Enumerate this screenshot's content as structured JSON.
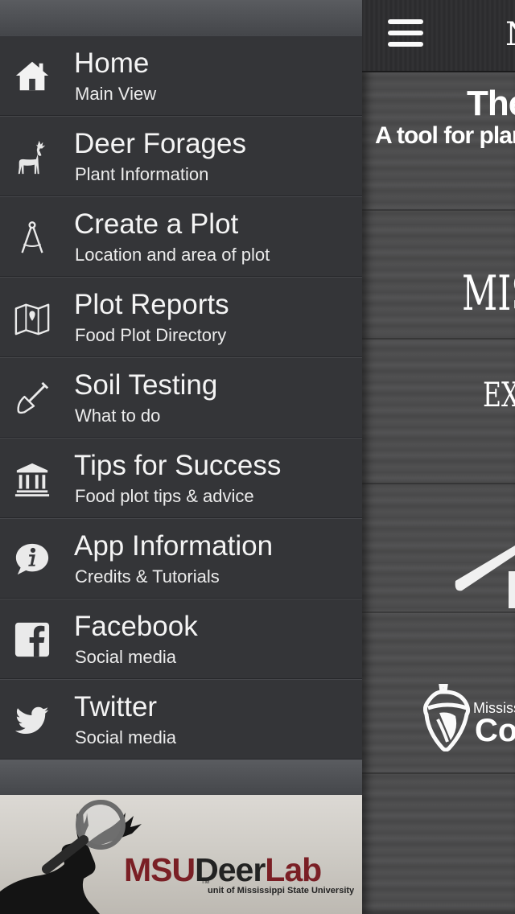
{
  "drawer": {
    "items": [
      {
        "title": "Home",
        "subtitle": "Main View",
        "icon": "home-icon"
      },
      {
        "title": "Deer Forages",
        "subtitle": "Plant Information",
        "icon": "deer-icon"
      },
      {
        "title": "Create a Plot",
        "subtitle": "Location and area of plot",
        "icon": "compass-icon"
      },
      {
        "title": "Plot Reports",
        "subtitle": "Food Plot Directory",
        "icon": "map-icon"
      },
      {
        "title": "Soil Testing",
        "subtitle": "What to do",
        "icon": "shovel-icon"
      },
      {
        "title": "Tips for Success",
        "subtitle": "Food plot tips & advice",
        "icon": "institution-icon"
      },
      {
        "title": "App Information",
        "subtitle": "Credits & Tutorials",
        "icon": "info-icon"
      },
      {
        "title": "Facebook",
        "subtitle": "Social media",
        "icon": "facebook-icon"
      },
      {
        "title": "Twitter",
        "subtitle": "Social media",
        "icon": "twitter-icon"
      }
    ],
    "logo": {
      "msu": "MSU",
      "deer": "Deer",
      "lab": "Lab",
      "tm": "TM",
      "tagline": "unit of Mississippi State University"
    }
  },
  "main": {
    "header_text": "N",
    "title": "The",
    "subtitle": "A tool for plan",
    "word1": "MIS",
    "word2": "EXT",
    "small_text": "Mississ",
    "small_word": "Col"
  },
  "colors": {
    "drawer_bg": "#343538",
    "logo_maroon": "#7a1f25",
    "text": "#f4f4f4"
  }
}
